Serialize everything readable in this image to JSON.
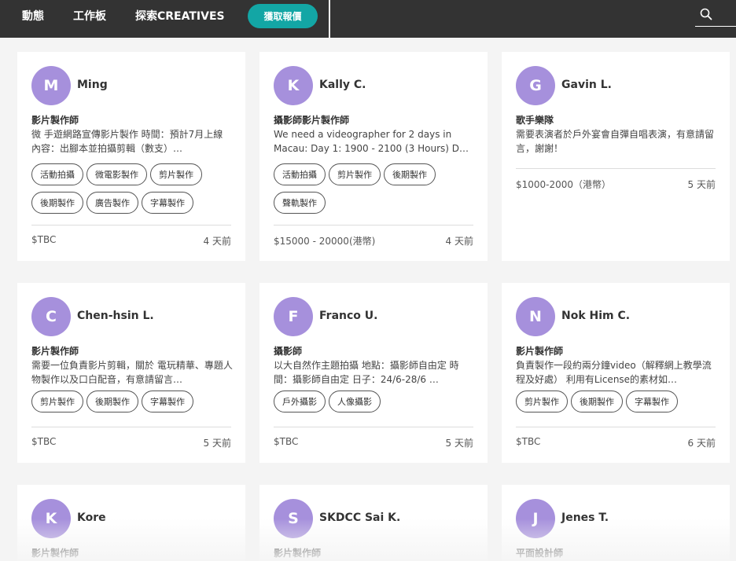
{
  "nav": {
    "items": [
      "動態",
      "工作板",
      "探索CREATIVES"
    ],
    "quote_button": "獲取報價"
  },
  "colors": {
    "topbar": "#333333",
    "accent": "#13a6a5",
    "avatar": "#a690dc"
  },
  "cards": [
    {
      "initial": "M",
      "name": "Ming",
      "role": "影片製作師",
      "desc": "微 手遊網路宣傳影片製作 時間：預計7月上線 內容：出腳本並拍攝剪輯（數支）…",
      "tags": [
        "活動拍攝",
        "微電影製作",
        "剪片製作",
        "後期製作",
        "廣告製作",
        "字幕製作"
      ],
      "budget": "$TBC",
      "time": "4 天前"
    },
    {
      "initial": "K",
      "name": "Kally C.",
      "role": "攝影師影片製作師",
      "desc": "We need a videographer for 2 days in Macau: Day 1: 1900 - 2100 (3 Hours) D…",
      "tags": [
        "活動拍攝",
        "剪片製作",
        "後期製作",
        "聲軌製作"
      ],
      "budget": "$15000 - 20000(港幣)",
      "time": "4 天前"
    },
    {
      "initial": "G",
      "name": "Gavin L.",
      "role": "歌手樂隊",
      "desc": "需要表演者於戶外宴會自彈自唱表演，有意請留言，謝謝！",
      "tags": [],
      "budget": "$1000-2000（港幣）",
      "time": "5 天前"
    },
    {
      "initial": "C",
      "name": "Chen-hsin L.",
      "role": "影片製作師",
      "desc": "需要一位負責影片剪輯，關於 電玩精華、專題人物製作以及口白配音，有意請留言…",
      "tags": [
        "剪片製作",
        "後期製作",
        "字幕製作"
      ],
      "budget": "$TBC",
      "time": "5 天前"
    },
    {
      "initial": "F",
      "name": "Franco U.",
      "role": "攝影師",
      "desc": "以大自然作主題拍攝 地點：攝影師自由定 時間：攝影師自由定 日子：24/6-28/6 …",
      "tags": [
        "戶外攝影",
        "人像攝影"
      ],
      "budget": "$TBC",
      "time": "5 天前"
    },
    {
      "initial": "N",
      "name": "Nok Him C.",
      "role": "影片製作師",
      "desc": "負責製作一段約兩分鐘video（解釋網上教學流程及好處） 利用有License的素材如…",
      "tags": [
        "剪片製作",
        "後期製作",
        "字幕製作"
      ],
      "budget": "$TBC",
      "time": "6 天前"
    },
    {
      "initial": "K",
      "name": "Kore",
      "role": "影片製作師"
    },
    {
      "initial": "S",
      "name": "SKDCC Sai K.",
      "role": "影片製作師"
    },
    {
      "initial": "J",
      "name": "Jenes T.",
      "role": "平面設計師"
    }
  ]
}
